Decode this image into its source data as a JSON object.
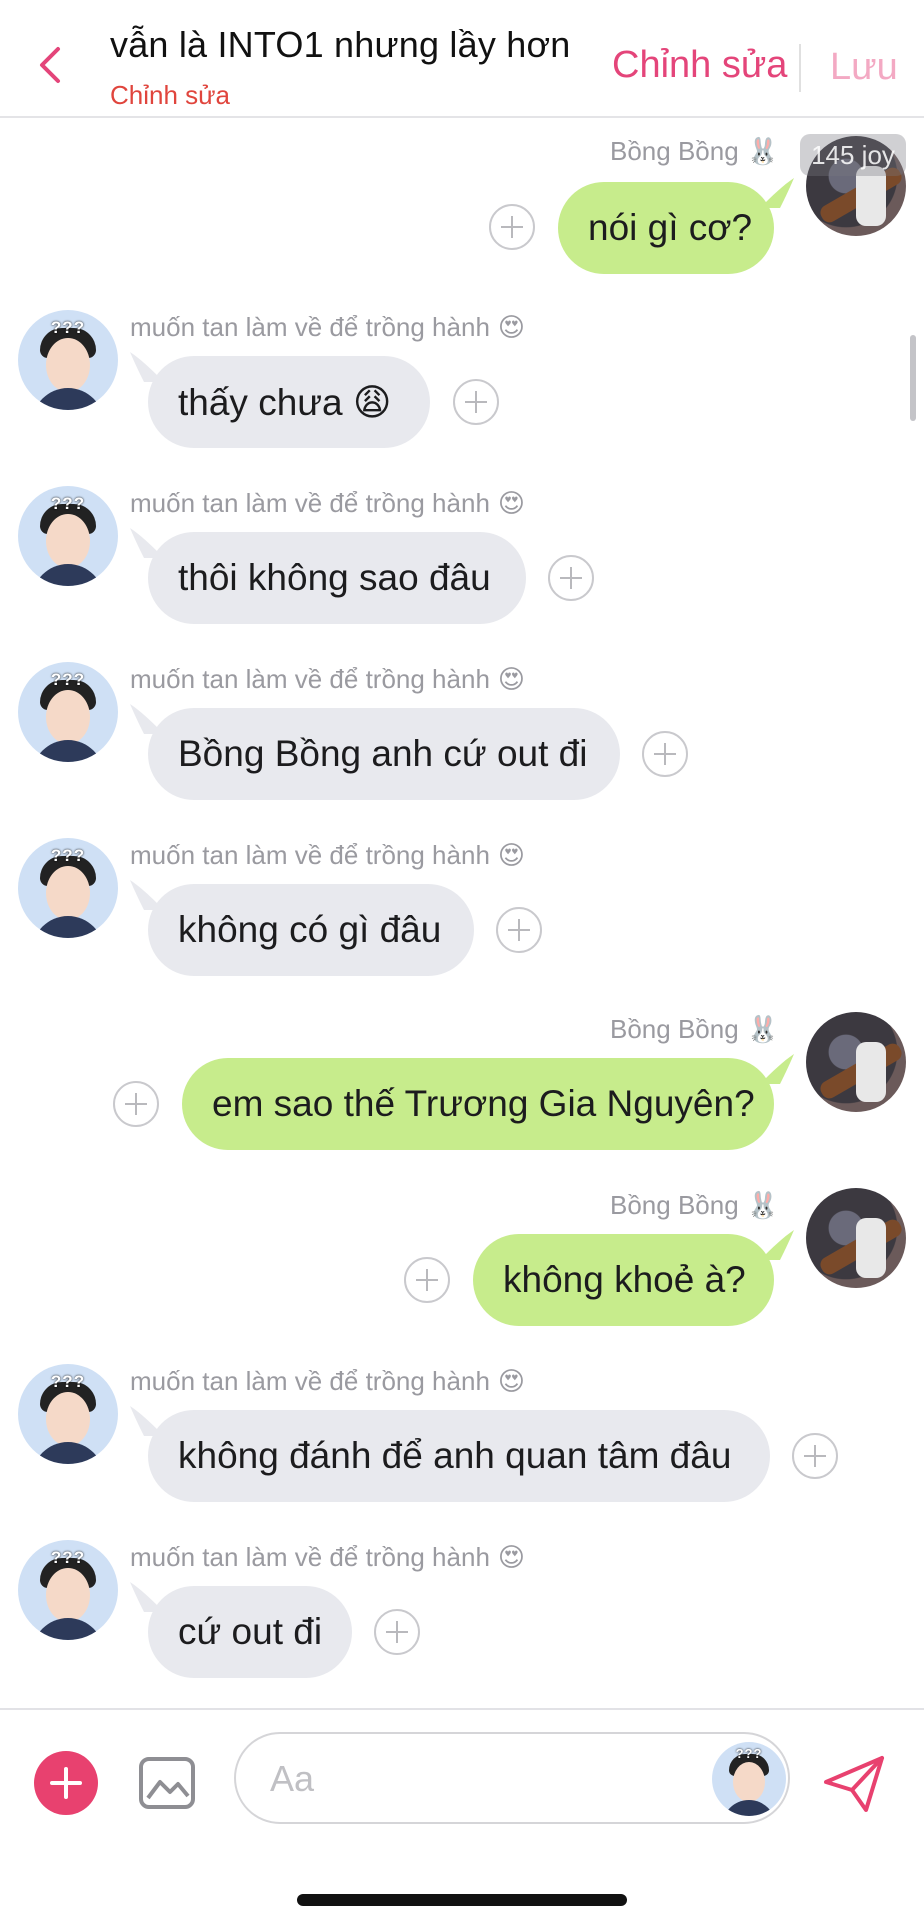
{
  "header": {
    "title": "vẫn là INTO1 nhưng lầy hơn",
    "subtitle": "Chỉnh sửa",
    "edit_label": "Chỉnh sửa",
    "save_label": "Lưu"
  },
  "overlay": {
    "joy_badge": "145 joy"
  },
  "messages": [
    {
      "side": "out",
      "sender": "Bồng Bồng",
      "emoji": "🐰",
      "text": "nói gì cơ?"
    },
    {
      "side": "in",
      "sender": "muốn tan làm về để trồng hành",
      "emoji": "😍",
      "text": "thấy chưa 😩"
    },
    {
      "side": "in",
      "sender": "muốn tan làm về để trồng hành",
      "emoji": "😍",
      "text": "thôi không sao đâu"
    },
    {
      "side": "in",
      "sender": "muốn tan làm về để trồng hành",
      "emoji": "😍",
      "text": "Bồng Bồng anh cứ out đi"
    },
    {
      "side": "in",
      "sender": "muốn tan làm về để trồng hành",
      "emoji": "😍",
      "text": "không có gì đâu"
    },
    {
      "side": "out",
      "sender": "Bồng Bồng",
      "emoji": "🐰",
      "text": "em sao thế Trương Gia Nguyên?"
    },
    {
      "side": "out",
      "sender": "Bồng Bồng",
      "emoji": "🐰",
      "text": "không khoẻ à?"
    },
    {
      "side": "in",
      "sender": "muốn tan làm về để trồng hành",
      "emoji": "😍",
      "text": "không đánh để anh quan tâm đâu"
    },
    {
      "side": "in",
      "sender": "muốn tan làm về để trồng hành",
      "emoji": "😍",
      "text": "cứ out đi"
    }
  ],
  "avatars": {
    "in_caption": "???"
  },
  "composer": {
    "placeholder": "Aa"
  },
  "colors": {
    "accent": "#e8416f",
    "incoming_bubble": "#e8e9ee",
    "outgoing_bubble": "#c7ec8c",
    "subtitle": "#e0453d"
  },
  "icons": {
    "back": "chevron-left-icon",
    "add": "plus-icon",
    "image": "image-icon",
    "send": "paper-plane-icon",
    "reaction": "plus-circle-icon"
  }
}
